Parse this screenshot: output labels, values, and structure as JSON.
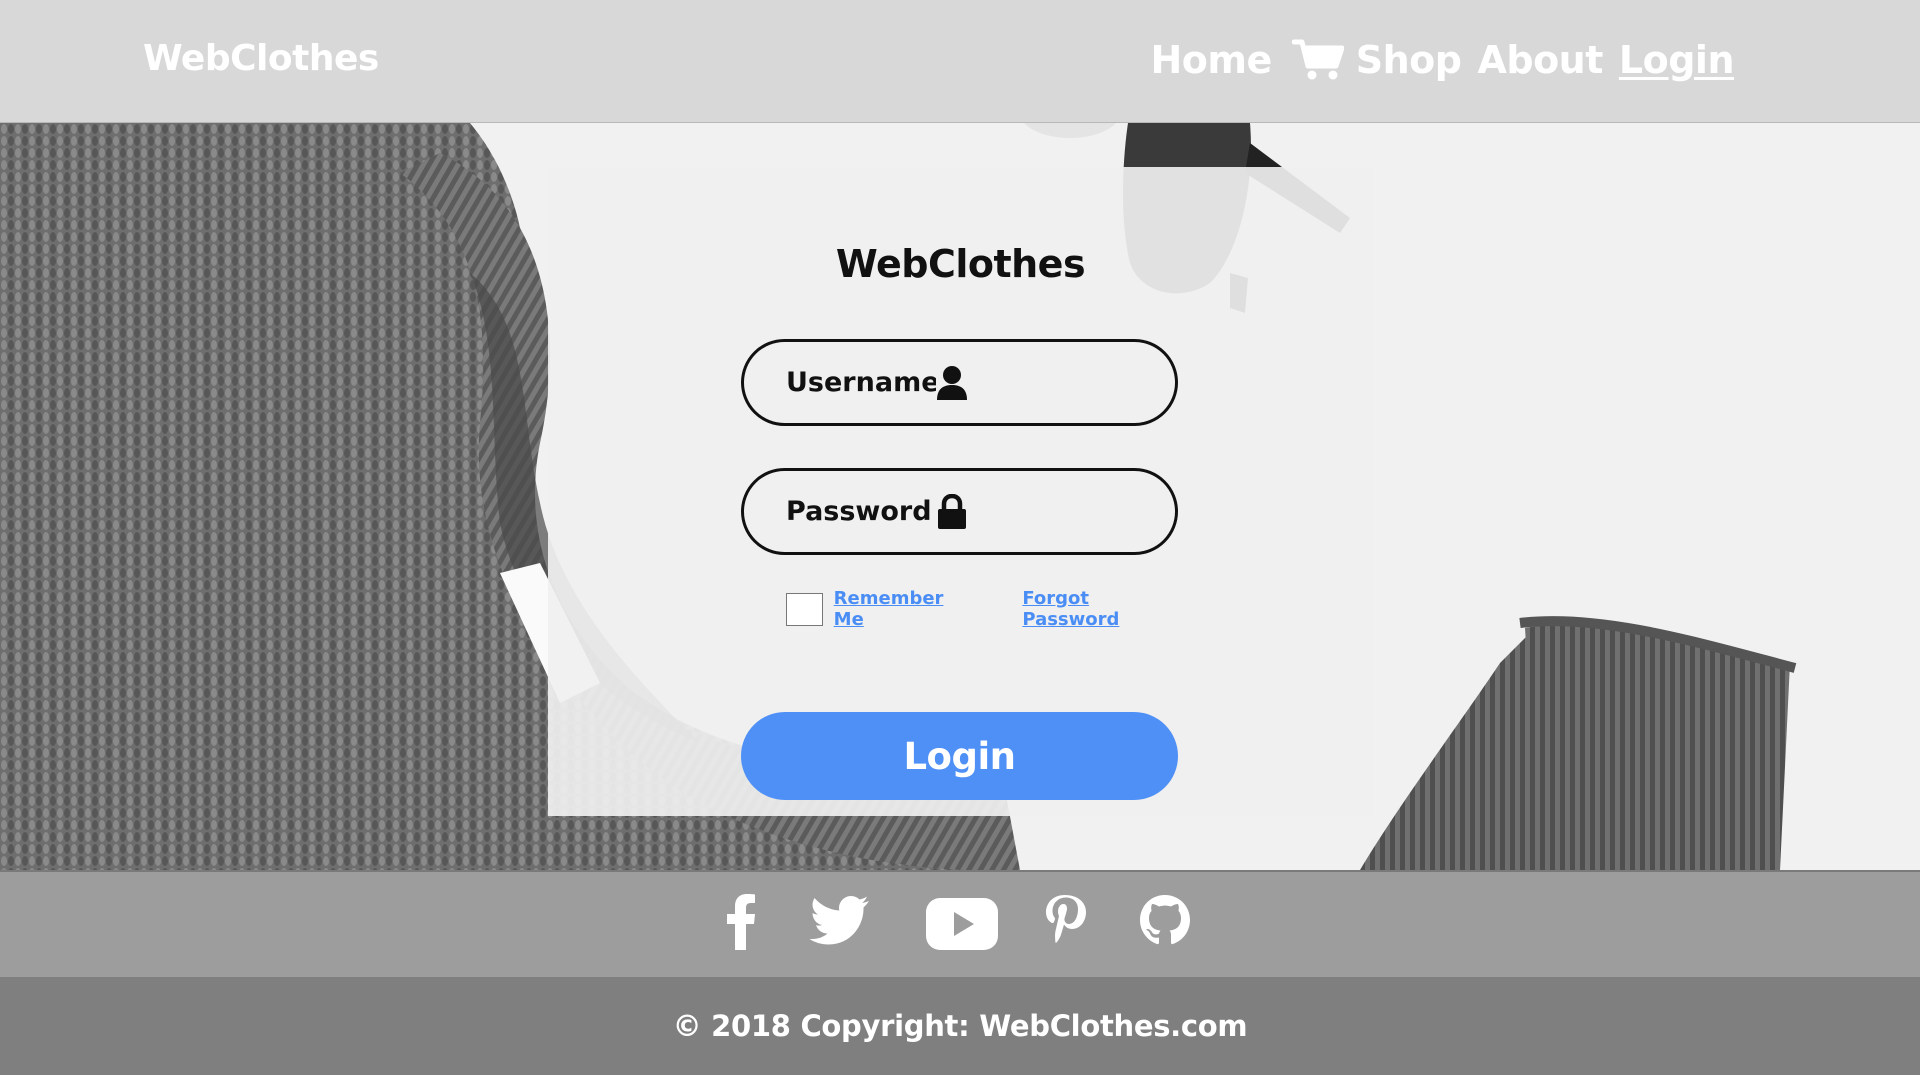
{
  "header": {
    "brand": "WebClothes",
    "nav": {
      "home": "Home",
      "shop": "Shop",
      "about": "About",
      "login": "Login",
      "cart_icon": "shopping-cart-icon"
    }
  },
  "login": {
    "title": "WebClothes",
    "username_placeholder": "Username",
    "password_placeholder": "Password",
    "username_icon": "user-icon",
    "password_icon": "lock-icon",
    "remember_label": "Remember Me",
    "remember_checked": false,
    "forgot_label": "Forgot Password",
    "submit_label": "Login"
  },
  "social": {
    "icons": [
      "facebook-icon",
      "twitter-icon",
      "youtube-icon",
      "pinterest-icon",
      "github-icon"
    ]
  },
  "footer": {
    "copyright": "© 2018 Copyright: WebClothes.com"
  },
  "colors": {
    "accent": "#4e90f6",
    "link": "#4a8ef5",
    "header_bg": "#d8d8d8",
    "social_bg": "#9d9d9d",
    "copyright_bg": "#7f7f7f"
  }
}
